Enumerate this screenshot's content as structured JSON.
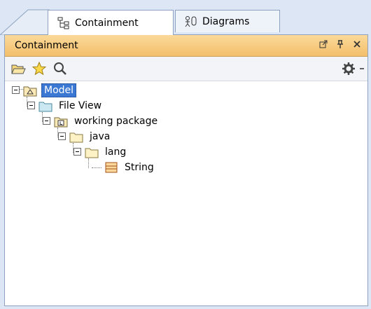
{
  "tabs": [
    {
      "label": "Containment",
      "icon": "containment-tree-icon",
      "active": true
    },
    {
      "label": "Diagrams",
      "icon": "diagrams-icon",
      "active": false
    }
  ],
  "panel": {
    "title": "Containment",
    "header_buttons": [
      "undock-icon",
      "pin-icon",
      "close-icon"
    ]
  },
  "toolbar": {
    "buttons": [
      "open-folder-icon",
      "star-icon",
      "search-icon"
    ],
    "right": [
      "gear-icon",
      "dropdown-arrow-icon"
    ]
  },
  "tree": [
    {
      "label": "Model",
      "icon": "model-icon",
      "depth": 0,
      "selected": true
    },
    {
      "label": "File View",
      "icon": "file-view-icon",
      "depth": 1
    },
    {
      "label": "working package",
      "icon": "package-icon",
      "depth": 2
    },
    {
      "label": "java",
      "icon": "folder-icon",
      "depth": 3
    },
    {
      "label": "lang",
      "icon": "folder-icon",
      "depth": 4
    },
    {
      "label": "String",
      "icon": "class-icon",
      "depth": 5
    }
  ],
  "colors": {
    "header_gradient_top": "#fbd99a",
    "header_gradient_bottom": "#f3bf6b",
    "selection": "#3a78d4",
    "background": "#dce6f4"
  }
}
